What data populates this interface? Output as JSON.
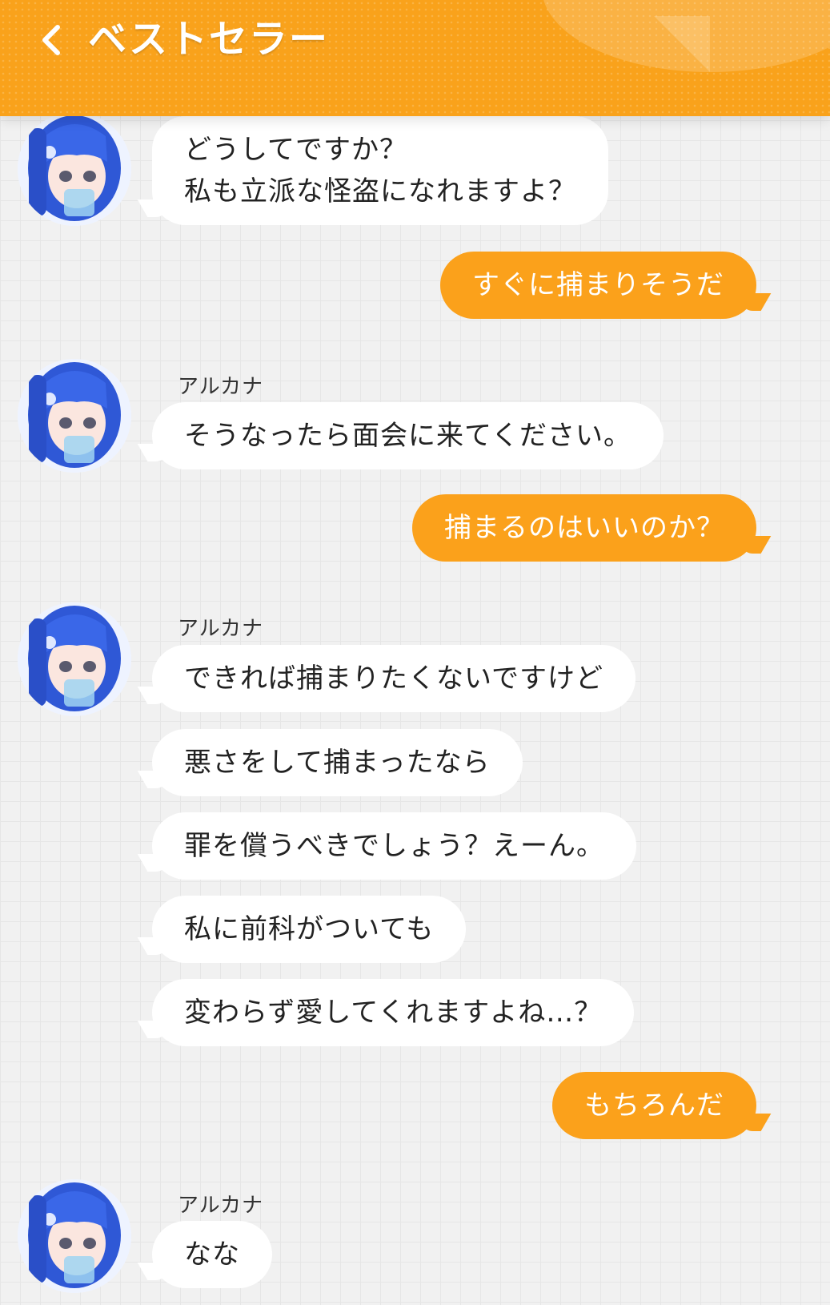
{
  "header": {
    "title": "ベストセラー",
    "back_icon": "chevron-left-icon"
  },
  "colors": {
    "accent": "#f9a21b",
    "bubble_out": "#fba11b",
    "bubble_in": "#ffffff",
    "background": "#f1f1f1"
  },
  "messages": [
    {
      "from": "other",
      "lines": [
        "どうしてですか？",
        "私も立派な怪盗になれますよ？"
      ]
    },
    {
      "from": "me",
      "text": "すぐに捕まりそうだ"
    },
    {
      "from": "other",
      "sender": "アルカナ",
      "text": "そうなったら面会に来てください。"
    },
    {
      "from": "me",
      "text": "捕まるのはいいのか？"
    },
    {
      "from": "other",
      "sender": "アルカナ",
      "text": "できれば捕まりたくないですけど"
    },
    {
      "from": "other",
      "text": "悪さをして捕まったなら"
    },
    {
      "from": "other",
      "text": "罪を償うべきでしょう？えーん。"
    },
    {
      "from": "other",
      "text": "私に前科がついても"
    },
    {
      "from": "other",
      "text": "変わらず愛してくれますよね…？"
    },
    {
      "from": "me",
      "text": "もちろんだ"
    },
    {
      "from": "other",
      "sender": "アルカナ",
      "text": "なな"
    }
  ]
}
